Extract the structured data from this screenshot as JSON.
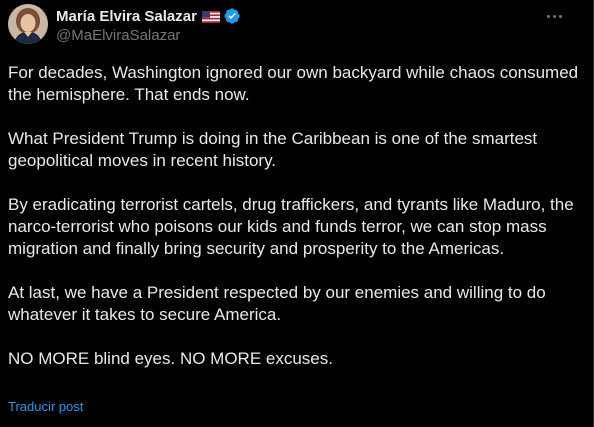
{
  "author": {
    "display_name": "María Elvira Salazar",
    "handle": "@MaElviraSalazar",
    "flag_icon": "us-flag-icon",
    "verified_icon": "verified-badge-icon"
  },
  "post": {
    "paragraphs": [
      "For decades, Washington ignored our own backyard while chaos consumed the hemisphere. That ends now.",
      "What President Trump is doing in the Caribbean is one of the smartest geopolitical moves in recent history.",
      "By eradicating terrorist cartels, drug traffickers, and tyrants like Maduro, the narco-terrorist who poisons our kids and funds terror, we can stop mass migration and finally bring security and prosperity to the Americas.",
      "At last, we have a President respected by our enemies and willing to do whatever it takes to secure America.",
      "NO MORE blind eyes. NO MORE excuses."
    ],
    "translate_label": "Traducir post"
  },
  "colors": {
    "background": "#000000",
    "text": "#e7e9ea",
    "muted": "#71767b",
    "accent": "#1d9bf0"
  }
}
